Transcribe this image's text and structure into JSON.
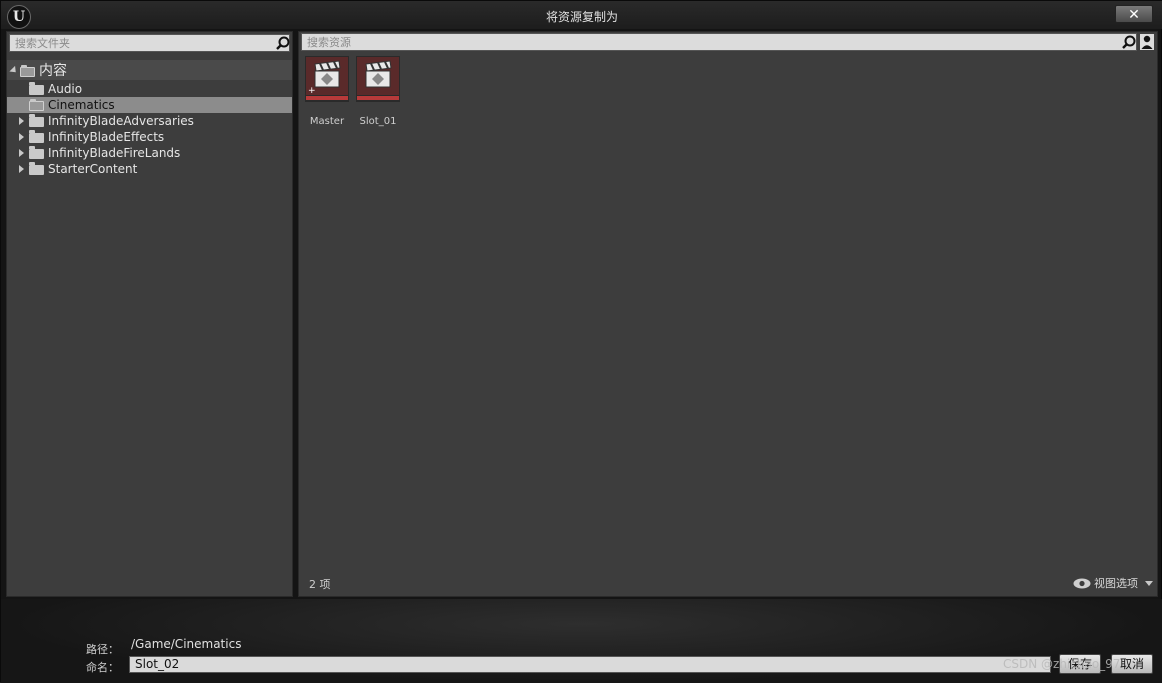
{
  "window": {
    "title": "将资源复制为",
    "logo": "U",
    "close_glyph": "✕"
  },
  "folder_panel": {
    "search_placeholder": "搜索文件夹",
    "root_label": "内容",
    "items": [
      {
        "label": "Audio",
        "expandable": false,
        "selected": false
      },
      {
        "label": "Cinematics",
        "expandable": false,
        "selected": true
      },
      {
        "label": "InfinityBladeAdversaries",
        "expandable": true,
        "selected": false
      },
      {
        "label": "InfinityBladeEffects",
        "expandable": true,
        "selected": false
      },
      {
        "label": "InfinityBladeFireLands",
        "expandable": true,
        "selected": false
      },
      {
        "label": "StarterContent",
        "expandable": true,
        "selected": false
      }
    ]
  },
  "asset_panel": {
    "search_placeholder": "搜索资源",
    "assets": [
      {
        "label": "Master",
        "icon": "level-sequence-icon"
      },
      {
        "label": "Slot_01",
        "icon": "level-sequence-icon"
      }
    ],
    "item_count": "2 项",
    "view_options_label": "视图选项"
  },
  "footer": {
    "path_label": "路径：",
    "path_value": "/Game/Cinematics",
    "name_label": "命名：",
    "name_value": "Slot_02",
    "save_label": "保存",
    "cancel_label": "取消",
    "watermark": "CSDN @zhichao_97"
  },
  "colors": {
    "panel_bg": "#3d3d3d",
    "selection": "#8c8c8c",
    "asset_accent": "#b83a3a"
  }
}
